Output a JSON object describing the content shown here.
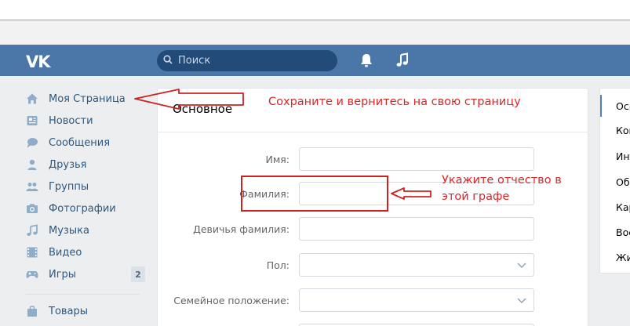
{
  "header": {
    "logo": "VK",
    "search_placeholder": "Поиск"
  },
  "sidebar": {
    "items": [
      {
        "label": "Моя Страница",
        "icon": "home-icon"
      },
      {
        "label": "Новости",
        "icon": "news-icon"
      },
      {
        "label": "Сообщения",
        "icon": "messages-icon"
      },
      {
        "label": "Друзья",
        "icon": "friend-icon"
      },
      {
        "label": "Группы",
        "icon": "groups-icon"
      },
      {
        "label": "Фотографии",
        "icon": "camera-icon"
      },
      {
        "label": "Музыка",
        "icon": "music-icon"
      },
      {
        "label": "Видео",
        "icon": "video-icon"
      },
      {
        "label": "Игры",
        "icon": "gamepad-icon",
        "badge": "2"
      },
      {
        "label": "Товары",
        "icon": "bag-icon"
      }
    ]
  },
  "panel": {
    "title": "Основное",
    "fields": [
      {
        "label": "Имя:",
        "value": "",
        "type": "text"
      },
      {
        "label": "Фамилия:",
        "value": "",
        "type": "text"
      },
      {
        "label": "Девичья фамилия:",
        "value": "",
        "type": "text"
      },
      {
        "label": "Пол:",
        "value": "",
        "type": "select"
      },
      {
        "label": "Семейное положение:",
        "value": "",
        "type": "select"
      }
    ]
  },
  "right_menu": {
    "items": [
      "Осн",
      "Кон",
      "Инт",
      "Обр",
      "Кар",
      "Вое",
      "Жиз"
    ],
    "active_index": 0
  },
  "annotations": {
    "top": "Сохраните и вернитесь на свою страницу",
    "middle": "Укажите отчество в этой графе"
  },
  "colors": {
    "header": "#4a76a8",
    "link": "#2a5885",
    "annotation": "#d62828"
  }
}
